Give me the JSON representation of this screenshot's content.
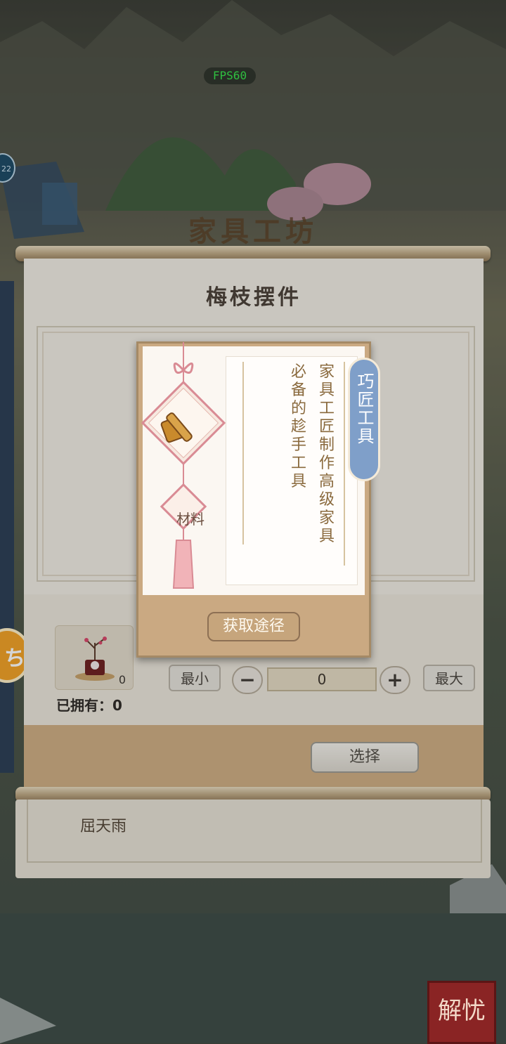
{
  "hud": {
    "fps": "FPS60",
    "left_badge": "22"
  },
  "workshop": {
    "sign": "家具工坊"
  },
  "panel": {
    "title": "梅枝摆件",
    "item_count": "0",
    "owned_label": "已拥有：",
    "owned_value": "0",
    "min_label": "最小",
    "max_label": "最大",
    "minus": "−",
    "plus": "+",
    "quantity": "0",
    "select_label": "选择"
  },
  "lower_list": {
    "name": "屈天雨"
  },
  "popup": {
    "category_tag": "巧匠工具",
    "type_label": "材料",
    "desc_line1": "家具工匠制作高级家具",
    "desc_line2": "必备的趁手工具",
    "acquire_label": "获取途径"
  },
  "corner_seal": "解忧",
  "colors": {
    "tag": "#7f9fc9",
    "fps": "#35e34a",
    "seal": "#8a2424"
  }
}
